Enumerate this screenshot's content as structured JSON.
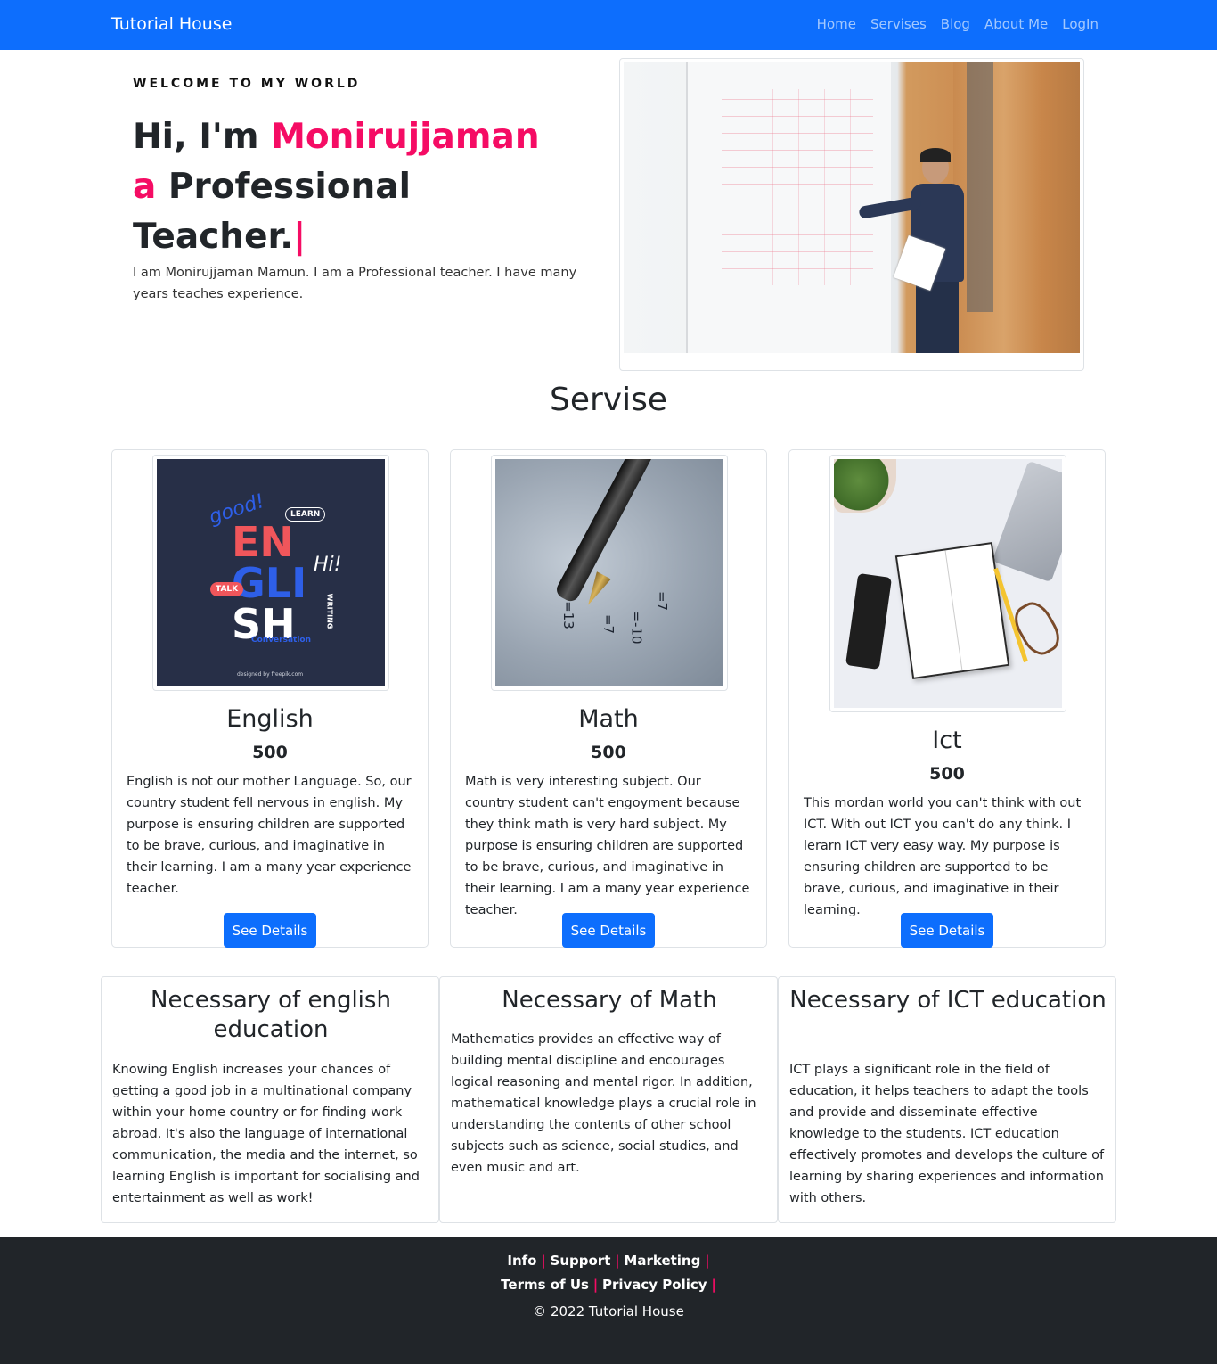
{
  "nav": {
    "brand": "Tutorial House",
    "links": [
      "Home",
      "Servises",
      "Blog",
      "About Me",
      "LogIn"
    ]
  },
  "hero": {
    "kicker": "WELCOME TO MY WORLD",
    "line1_prefix": "Hi, I'm ",
    "name": "Monirujjaman",
    "line2_prefix": "a",
    "line2_rest": " Professional Teacher.",
    "cursor": "|",
    "description": "I am Monirujjaman Mamun. I am a Professional teacher. I have many years teaches experience."
  },
  "services": {
    "title": "Servise",
    "cards": [
      {
        "title": "English",
        "price": "500",
        "text": "English is not our mother Language. So, our country student fell nervous in english. My purpose is ensuring children are supported to be brave, curious, and imaginative in their learning. I am a many year experience teacher.",
        "button": "See Details",
        "image_text": {
          "good": "good!",
          "learn": "LEARN",
          "l1": "EN",
          "l2": "GLI",
          "l3": "SH",
          "hi": "Hi!",
          "talk": "TALK",
          "writing": "WRITING",
          "conversation": "Conversation",
          "credit": "designed by freepik.com"
        }
      },
      {
        "title": "Math",
        "price": "500",
        "text": "Math is very interesting subject. Our country student can't engoyment because they think math is very hard subject. My purpose is ensuring children are supported to be brave, curious, and imaginative in their learning. I am a many year experience teacher.",
        "button": "See Details",
        "image_text": {
          "eq1": "=13",
          "eq2": "=7",
          "eq3": "=-10",
          "eq4": "=7"
        }
      },
      {
        "title": "Ict",
        "price": "500",
        "text": "This mordan world you can't think with out ICT. With out ICT you can't do any think. I lerarn ICT very easy way. My purpose is ensuring children are supported to be brave, curious, and imaginative in their learning.",
        "button": "See Details"
      }
    ]
  },
  "necessary": [
    {
      "title": "Necessary of english education",
      "text": "Knowing English increases your chances of getting a good job in a multinational company within your home country or for finding work abroad. It's also the language of international communication, the media and the internet, so learning English is important for socialising and entertainment as well as work!"
    },
    {
      "title": "Necessary of Math",
      "text": "Mathematics provides an effective way of building mental discipline and encourages logical reasoning and mental rigor. In addition, mathematical knowledge plays a crucial role in understanding the contents of other school subjects such as science, social studies, and even music and art."
    },
    {
      "title": "Necessary of ICT education",
      "text": "ICT plays a significant role in the field of education, it helps teachers to adapt the tools and provide and disseminate effective knowledge to the students. ICT education effectively promotes and develops the culture of learning by sharing experiences and information with others."
    }
  ],
  "footer": {
    "row1": [
      "Info",
      "Support",
      "Marketing"
    ],
    "row2": [
      "Terms of Us",
      "Privacy Policy"
    ],
    "separator": "|",
    "copyright": "© 2022 Tutorial House"
  },
  "colors": {
    "primary": "#0d6efd",
    "accent": "#f50c64",
    "footer_bg": "#212529"
  }
}
